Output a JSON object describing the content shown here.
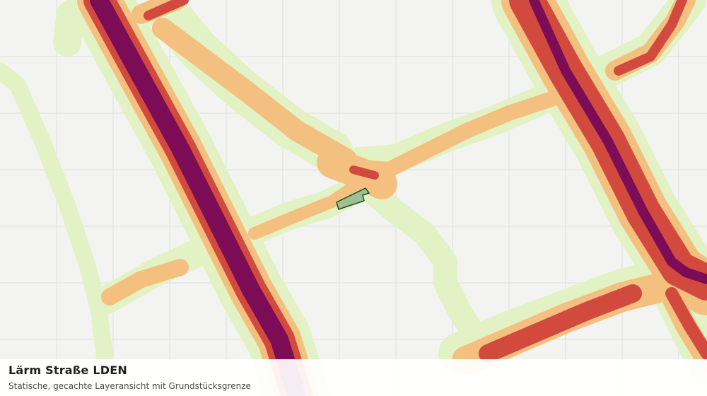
{
  "map": {
    "title": "Lärm Straße LDEN",
    "subtitle": "Statische, gecachte Layeransicht mit Grundstücksgrenze",
    "colors": {
      "background": "#f3f4f2",
      "grid": "#dcdfdb",
      "noise_band_1": "#e3f2c4",
      "noise_band_2": "#f3c07f",
      "noise_band_3": "#d24a3e",
      "noise_band_4": "#7b0c55",
      "parcel_fill": "#9fbf93",
      "parcel_outline": "#1e4a22"
    },
    "layers": [
      "noise-road-lden",
      "parcel-boundary"
    ]
  }
}
